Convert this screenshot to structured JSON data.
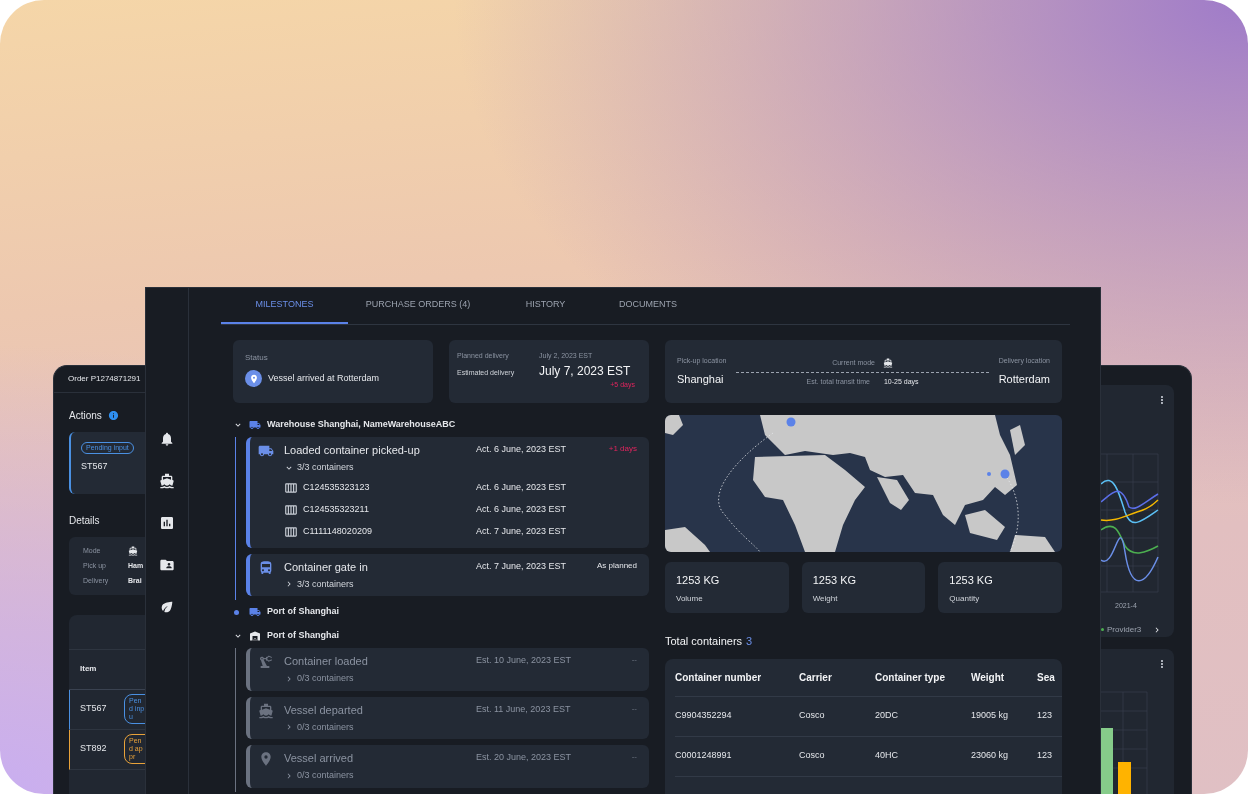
{
  "left_window": {
    "title": "Order P1274871291",
    "actions_heading": "Actions",
    "action_card": {
      "badge": "Pending input",
      "id": "ST567"
    },
    "details_heading": "Details",
    "details": [
      {
        "label": "Mode",
        "kind": "icon"
      },
      {
        "label": "Pick up",
        "kind": "text",
        "value": "Ham"
      },
      {
        "label": "Delivery",
        "kind": "text",
        "value": "Brai"
      }
    ],
    "table": {
      "column": "Item",
      "rows": [
        {
          "id": "ST567",
          "badge": "Pend inpu",
          "color": "#4a90e2"
        },
        {
          "id": "ST892",
          "badge": "Pend appr",
          "color": "#e8a23a"
        }
      ]
    }
  },
  "tabs": [
    {
      "label": "MILESTONES",
      "selected": true
    },
    {
      "label": "PURCHASE ORDERS (4)",
      "selected": false
    },
    {
      "label": "HISTORY",
      "selected": false
    },
    {
      "label": "DOCUMENTS",
      "selected": false
    }
  ],
  "status": {
    "label": "Status",
    "value": "Vessel arrived at Rotterdam"
  },
  "delivery": {
    "planned_label": "Planned delivery",
    "planned_date": "July 2, 2023 EST",
    "estimated_label": "Estimated delivery",
    "estimated_date": "July 7, 2023 EST",
    "delay": "+5 days"
  },
  "timeline": [
    {
      "kind": "road_group",
      "label": "Warehouse Shanghai, NameWarehouseABC",
      "expanded": true,
      "milestones": [
        {
          "kind": "pickup",
          "title": "Loaded container picked-up",
          "date": "Act. 6 June, 2023 EST",
          "note": {
            "text": "+1 days",
            "kind": "late"
          },
          "done": true,
          "containers": "3/3 containers",
          "expanded": true,
          "items": [
            {
              "number": "C124535323123",
              "date": "Act. 6 June, 2023 EST"
            },
            {
              "number": "C124535323211",
              "date": "Act. 6 June, 2023 EST"
            },
            {
              "number": "C1111148020209",
              "date": "Act. 7 June, 2023 EST"
            }
          ]
        },
        {
          "kind": "gate",
          "title": "Container gate in",
          "date": "Act. 7 June, 2023 EST",
          "note": {
            "text": "As planned",
            "kind": "on_time"
          },
          "done": true,
          "containers": "3/3 containers",
          "expanded": false
        }
      ]
    },
    {
      "kind": "road_stop",
      "label": "Port of Shanghai"
    },
    {
      "kind": "port_group",
      "label": "Port of Shanghai",
      "expanded": true,
      "milestones": [
        {
          "kind": "loaded",
          "title": "Container loaded",
          "date": "Est. 10 June, 2023 EST",
          "note": {
            "text": "--",
            "kind": "pending"
          },
          "done": false,
          "containers": "0/3 containers",
          "expanded": false
        },
        {
          "kind": "departed",
          "title": "Vessel departed",
          "date": "Est. 11 June, 2023 EST",
          "note": {
            "text": "--",
            "kind": "pending"
          },
          "done": false,
          "containers": "0/3 containers",
          "expanded": false
        },
        {
          "kind": "arrived",
          "title": "Vessel arrived",
          "date": "Est. 20 June, 2023 EST",
          "note": {
            "text": "--",
            "kind": "pending"
          },
          "done": false,
          "containers": "0/3 containers",
          "expanded": false
        }
      ]
    }
  ],
  "route": {
    "pickup_label": "Pick-up location",
    "pickup": "Shanghai",
    "mode_label": "Current mode",
    "transit_label": "Est. total transit time",
    "transit": "10-25 days",
    "delivery_label": "Delivery location",
    "delivery": "Rotterdam"
  },
  "stats": [
    {
      "value": "1253 KG",
      "label": "Volume"
    },
    {
      "value": "1253 KG",
      "label": "Weight"
    },
    {
      "value": "1253 KG",
      "label": "Quantity"
    }
  ],
  "containers": {
    "title": "Total containers",
    "count": "3",
    "columns": [
      "Container number",
      "Carrier",
      "Container type",
      "Weight",
      "Sea"
    ],
    "rows": [
      [
        "C9904352294",
        "Cosco",
        "20DC",
        "19005 kg",
        "123"
      ],
      [
        "C0001248991",
        "Cosco",
        "40HC",
        "23060 kg",
        "123"
      ]
    ]
  },
  "right_window": {
    "axis_label": "2021-4",
    "legend": "Provider3"
  }
}
